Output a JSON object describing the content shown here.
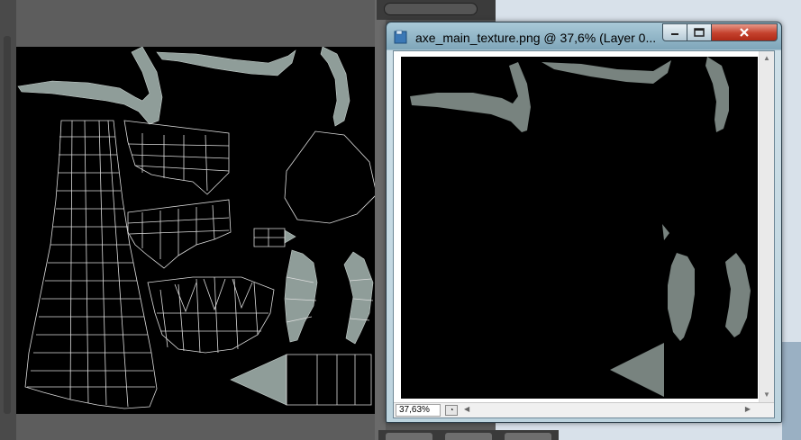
{
  "document_window": {
    "title": "axe_main_texture.png @ 37,6% (Layer 0...",
    "zoom": "37,63%",
    "icons": {
      "app": "photoshop-doc-icon",
      "minimize": "minimize-icon",
      "maximize": "maximize-icon",
      "close": "close-icon",
      "status": "document-info-icon"
    }
  },
  "colors": {
    "uv_fill": "#8f9d99",
    "uv_wire": "#dcdcdc",
    "texture_fill": "#78837f",
    "canvas_bg": "#000000",
    "close_button": "#c4412d"
  }
}
